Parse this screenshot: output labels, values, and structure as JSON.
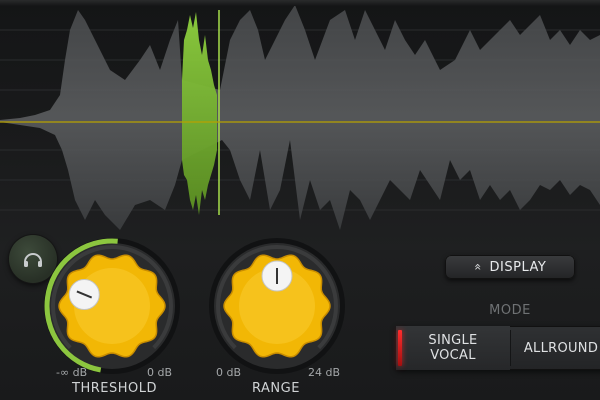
{
  "display": {
    "button_label": "DISPLAY",
    "chevron_glyph": "«"
  },
  "mode": {
    "label": "MODE",
    "options": [
      {
        "label": "SINGLE\nVOCAL",
        "line1": "SINGLE",
        "line2": "VOCAL",
        "selected": true
      },
      {
        "label": "ALLROUND",
        "selected": false
      }
    ]
  },
  "threshold": {
    "label": "THRESHOLD",
    "min_label": "-∞ dB",
    "max_label": "0 dB",
    "level": 0.25
  },
  "range": {
    "label": "RANGE",
    "min_label": "0 dB",
    "max_label": "24 dB",
    "level": 0.5
  },
  "colors": {
    "knob_yellow": "#f2b705",
    "meter_green": "#8cc63f",
    "active_red": "#e02020",
    "threshold_line": "#b8a200",
    "waveform_grey": "#6a6c6e",
    "waveform_highlight": "#8fd13f"
  },
  "icons": {
    "monitor": "headphones-icon"
  }
}
